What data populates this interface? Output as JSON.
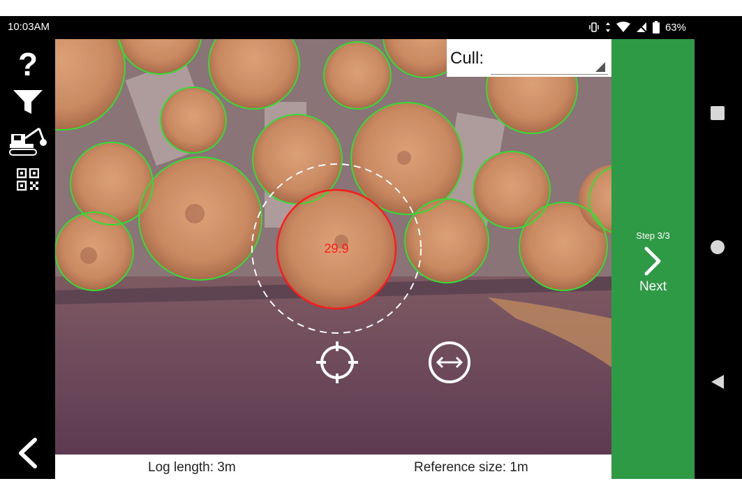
{
  "status_bar": {
    "time": "10:03AM",
    "battery_percent": "63%",
    "icons": [
      "vibrate-icon",
      "data-arrows-icon",
      "wifi-icon",
      "no-signal-icon",
      "battery-icon"
    ]
  },
  "left_toolbar": {
    "items": [
      {
        "name": "help-icon",
        "glyph": "?"
      },
      {
        "name": "filter-icon"
      },
      {
        "name": "harvester-icon"
      },
      {
        "name": "qr-code-icon"
      }
    ],
    "back_icon": "chevron-left-icon"
  },
  "cull": {
    "label": "Cull:",
    "value": ""
  },
  "measurement": {
    "selected_log_diameter": "29.9",
    "selected_color": "#ff1a1a",
    "detected_color": "#33dd33"
  },
  "controls": {
    "center_icon": "crosshair-icon",
    "resize_icon": "resize-horizontal-icon"
  },
  "bottom_info": {
    "log_length": "Log length: 3m",
    "reference_size": "Reference size: 1m"
  },
  "next_panel": {
    "step": "Step 3/3",
    "label": "Next",
    "color": "#2f9a46"
  },
  "system_nav": {
    "buttons": [
      "recents-square-icon",
      "home-circle-icon",
      "back-triangle-icon"
    ]
  }
}
